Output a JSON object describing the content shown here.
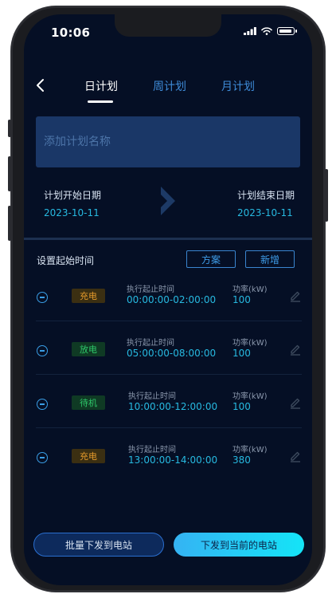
{
  "status": {
    "time": "10:06"
  },
  "icons": {
    "back": "chevron-left-icon",
    "signal": "signal-icon",
    "wifi": "wifi-icon",
    "battery": "battery-icon",
    "divider_arrow": "chevron-right-icon",
    "remove": "minus-circle-icon",
    "edit": "pencil-icon"
  },
  "tabs": [
    {
      "label": "日计划",
      "active": true
    },
    {
      "label": "周计划",
      "active": false
    },
    {
      "label": "月计划",
      "active": false
    }
  ],
  "plan_name": {
    "value": "",
    "placeholder": "添加计划名称"
  },
  "dates": {
    "start_label": "计划开始日期",
    "start_value": "2023-10-11",
    "end_label": "计划结束日期",
    "end_value": "2023-10-11"
  },
  "schedule": {
    "title": "设置起始时间",
    "scheme_button": "方案",
    "add_button": "新增",
    "exec_label": "执行起止时间",
    "power_label": "功率(kW)",
    "rows": [
      {
        "mode": "充电",
        "time_range": "00:00:00-02:00:00",
        "power": "100"
      },
      {
        "mode": "放电",
        "time_range": "05:00:00-08:00:00",
        "power": "100"
      },
      {
        "mode": "待机",
        "time_range": "10:00:00-12:00:00",
        "power": "100"
      },
      {
        "mode": "充电",
        "time_range": "13:00:00-14:00:00",
        "power": "380"
      }
    ]
  },
  "actions": {
    "batch_send": "批量下发到电站",
    "send_current": "下发到当前的电站"
  },
  "colors": {
    "background": "#050f25",
    "accent": "#27b9e0",
    "charge": "#e59a2b",
    "discharge": "#2ec86a",
    "standby": "#2ec86a"
  }
}
